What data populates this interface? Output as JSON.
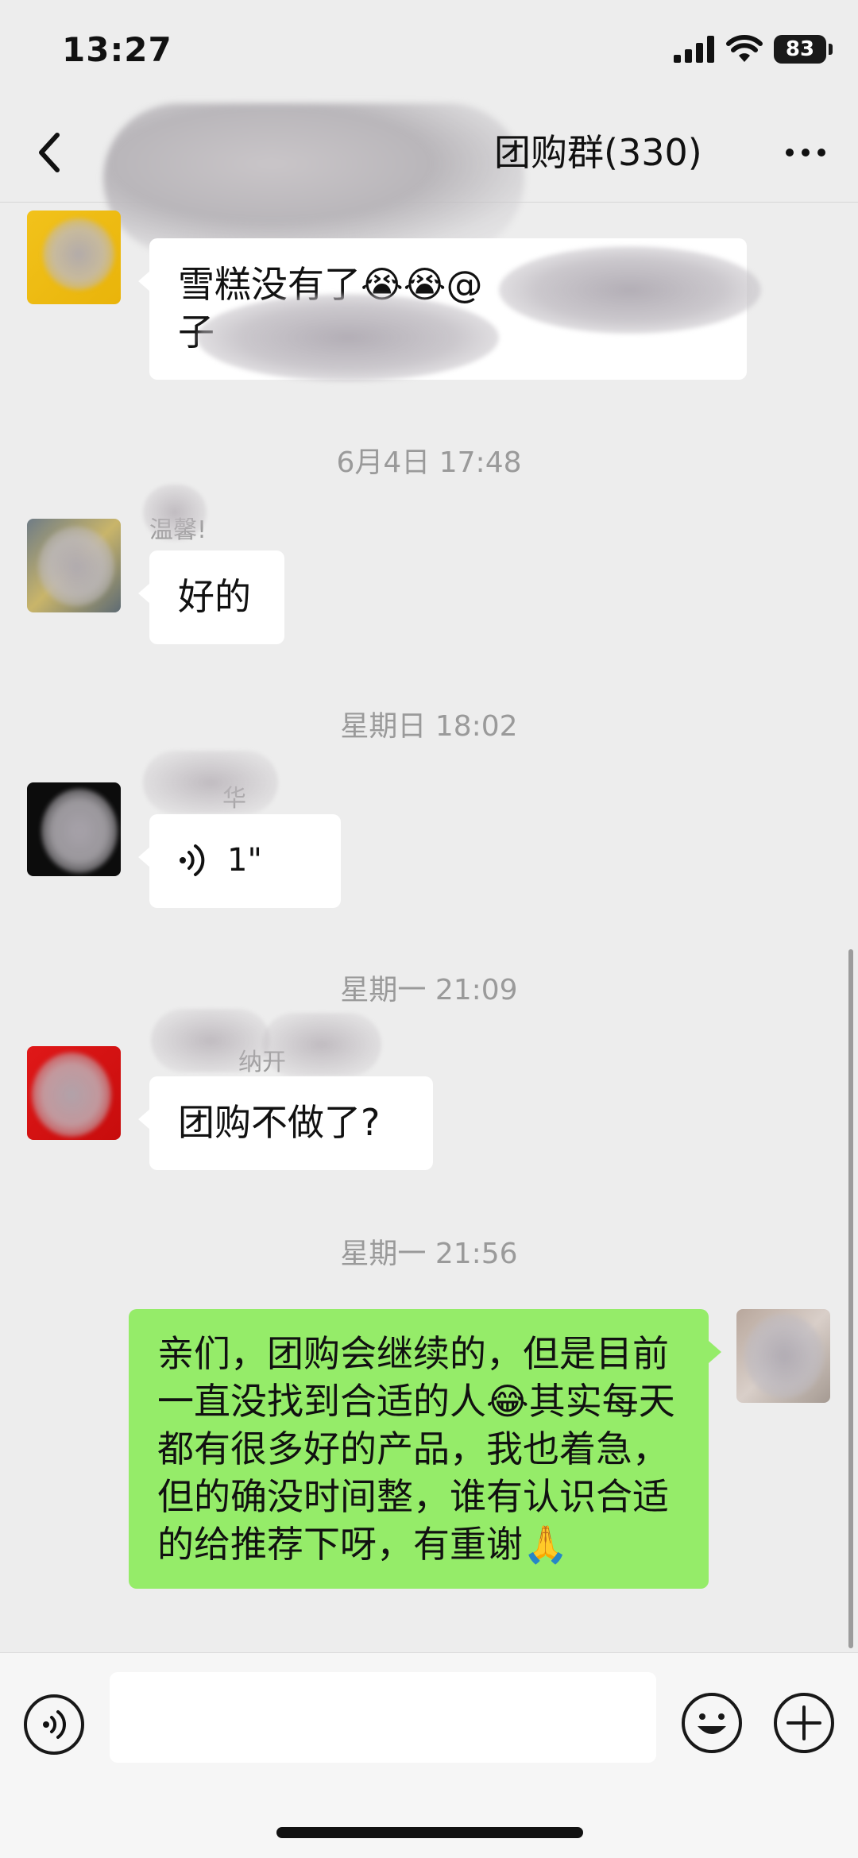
{
  "status_bar": {
    "time": "13:27",
    "battery": "83"
  },
  "header": {
    "title": "团购群(330)"
  },
  "messages": [
    {
      "text_line1": "雪糕没有了😭😭@",
      "text_line2": "子"
    },
    {
      "time": "6月4日 17:48",
      "sender": "温馨!",
      "text": "好的"
    },
    {
      "time": "星期日 18:02",
      "sender": "华",
      "voice_duration": "1\""
    },
    {
      "time": "星期一 21:09",
      "sender": "纳开",
      "text": "团购不做了?"
    },
    {
      "time": "星期一 21:56",
      "text": "亲们，团购会继续的，但是目前一直没找到合适的人😂其实每天都有很多好的产品，我也着急，但的确没时间整，谁有认识合适的给推荐下呀，有重谢🙏"
    }
  ],
  "input": {
    "value": ""
  },
  "colors": {
    "self_bubble": "#95ec69",
    "other_bubble": "#ffffff",
    "background": "#ededed"
  }
}
